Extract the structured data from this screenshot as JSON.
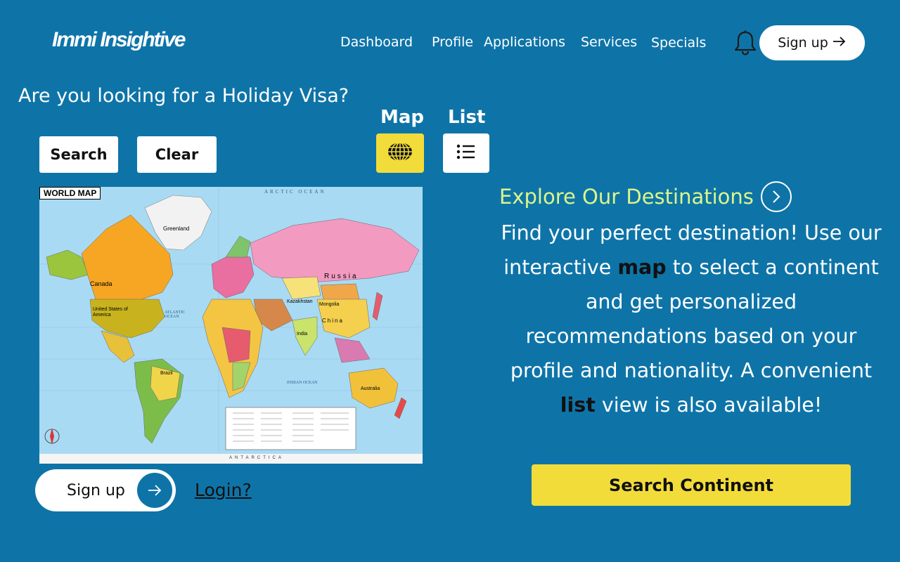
{
  "header": {
    "logo": "Immi Insightive",
    "nav": [
      "Dashboard",
      "Profile",
      "Applications",
      "Services",
      "Specials"
    ],
    "signup_label": "Sign up",
    "bell_icon": "bell-icon",
    "arrow_icon": "arrow-right-icon"
  },
  "hero": {
    "question": "Are you looking for a Holiday Visa?"
  },
  "controls": {
    "search_label": "Search",
    "clear_label": "Clear",
    "map_label": "Map",
    "list_label": "List",
    "map_icon": "globe-icon",
    "list_icon": "list-icon",
    "active_view": "Map",
    "active_color": "#f2dc3a"
  },
  "map": {
    "title": "WORLD MAP",
    "labels": {
      "greenland": "Greenland",
      "canada": "Canada",
      "usa": "United States of America",
      "russia": "Russia",
      "china": "China",
      "australia": "Australia",
      "brazil": "Brazil",
      "india": "India",
      "arctic": "ARCTIC OCEAN",
      "atlantic": "ATLANTIC OCEAN",
      "indian": "INDIAN OCEAN",
      "antarctica": "ANTARCTICA",
      "mongolia": "Mongolia",
      "kazakhstan": "Kazakhstan"
    }
  },
  "footer_left": {
    "signup_label": "Sign up",
    "login_label": "Login?"
  },
  "right_panel": {
    "explore_title": "Explore Our Destinations",
    "explore_icon": "chevron-right-icon",
    "desc_part1": "Find your perfect destination! Use our interactive ",
    "desc_map": "map",
    "desc_part2": " to select a continent and get personalized recommendations based on your profile and nationality. A convenient ",
    "desc_list": "list",
    "desc_part3": " view is also available!",
    "search_continent_label": "Search Continent"
  },
  "colors": {
    "background": "#0e74a8",
    "accent_yellow": "#f2dc3a",
    "explore_green": "#dcf58a"
  }
}
